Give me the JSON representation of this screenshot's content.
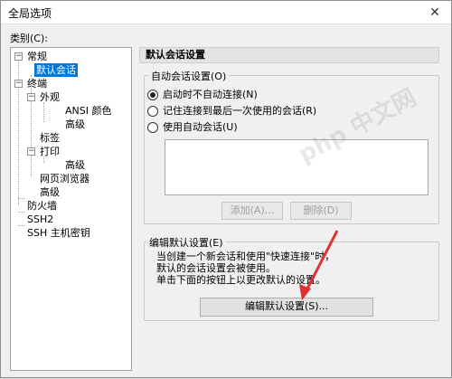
{
  "window": {
    "title": "全局选项",
    "close_glyph": "✕"
  },
  "category_label": "类别(C):",
  "tree": {
    "expand_glyph": "−",
    "items": [
      {
        "label": "常规",
        "level": 0,
        "expander": true
      },
      {
        "label": "默认会话",
        "level": 1,
        "selected": true
      },
      {
        "label": "终端",
        "level": 0,
        "expander": true
      },
      {
        "label": "外观",
        "level": 1,
        "expander": true
      },
      {
        "label": "ANSI 颜色",
        "level": 2
      },
      {
        "label": "高级",
        "level": 2
      },
      {
        "label": "标签",
        "level": 1
      },
      {
        "label": "打印",
        "level": 1,
        "expander": true
      },
      {
        "label": "高级",
        "level": 2
      },
      {
        "label": "网页浏览器",
        "level": 1
      },
      {
        "label": "高级",
        "level": 1
      },
      {
        "label": "防火墙",
        "level": 0
      },
      {
        "label": "SSH2",
        "level": 0
      },
      {
        "label": "SSH 主机密钥",
        "level": 0
      }
    ]
  },
  "panel": {
    "header": "默认会话设置",
    "auto_session_group": {
      "label": "自动会话设置(O)",
      "options": [
        {
          "label": "启动时不自动连接(N)",
          "checked": true
        },
        {
          "label": "记住连接到最后一次使用的会话(R)",
          "checked": false
        },
        {
          "label": "使用自动会话(U)",
          "checked": false
        }
      ],
      "add_button": "添加(A)...",
      "delete_button": "删除(D)"
    },
    "edit_group": {
      "label": "编辑默认设置(E)",
      "description": [
        "当创建一个新会话和使用\"快速连接\"时，",
        "默认的会话设置会被使用。",
        "单击下面的按钮上以更改默认的设置。"
      ],
      "edit_button": "编辑默认设置(S)..."
    }
  },
  "watermark": "php 中文网",
  "colors": {
    "selection": "#0078d7",
    "arrow": "#e03030"
  }
}
